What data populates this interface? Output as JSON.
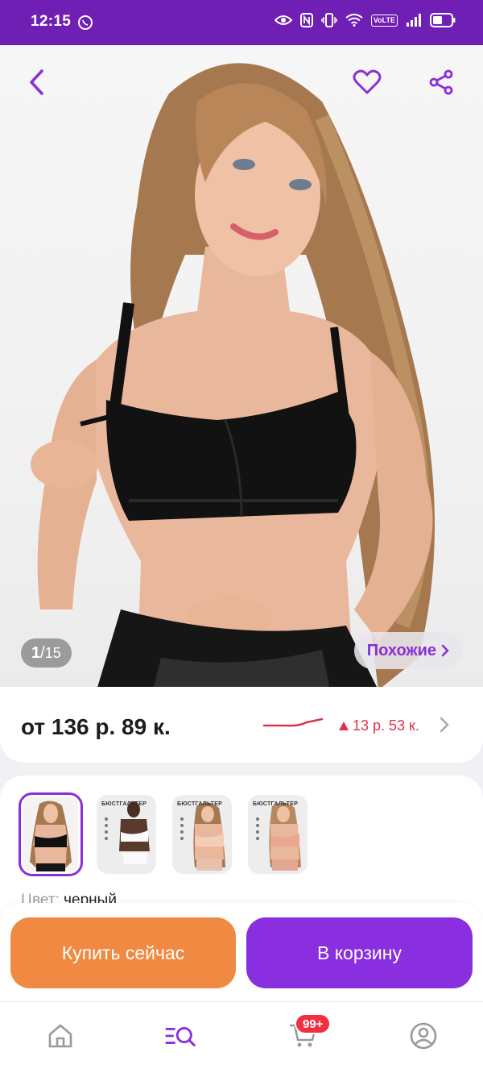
{
  "status_bar": {
    "time": "12:15",
    "volte": "VoLTE"
  },
  "gallery": {
    "counter_current": "1",
    "counter_total": "15",
    "similar_label": "Похожие"
  },
  "price": {
    "main": "от 136 р. 89 к.",
    "delta": "13 р. 53 к."
  },
  "variants": {
    "thumbs": [
      {
        "label": ""
      },
      {
        "label": "БЮСТГАЛЬТЕР"
      },
      {
        "label": "БЮСТГАЛЬТЕР"
      },
      {
        "label": "БЮСТГАЛЬТЕР"
      }
    ],
    "color_label": "Цвет:",
    "color_value": "черный"
  },
  "actions": {
    "buy_now": "Купить сейчас",
    "to_cart": "В корзину"
  },
  "bottom_nav": {
    "cart_badge": "99+"
  },
  "colors": {
    "status_bar": "#6f1fb4",
    "accent": "#8a2fe0",
    "buy_now": "#f08a42",
    "price_delta": "#e0334a",
    "badge": "#f0303f"
  }
}
